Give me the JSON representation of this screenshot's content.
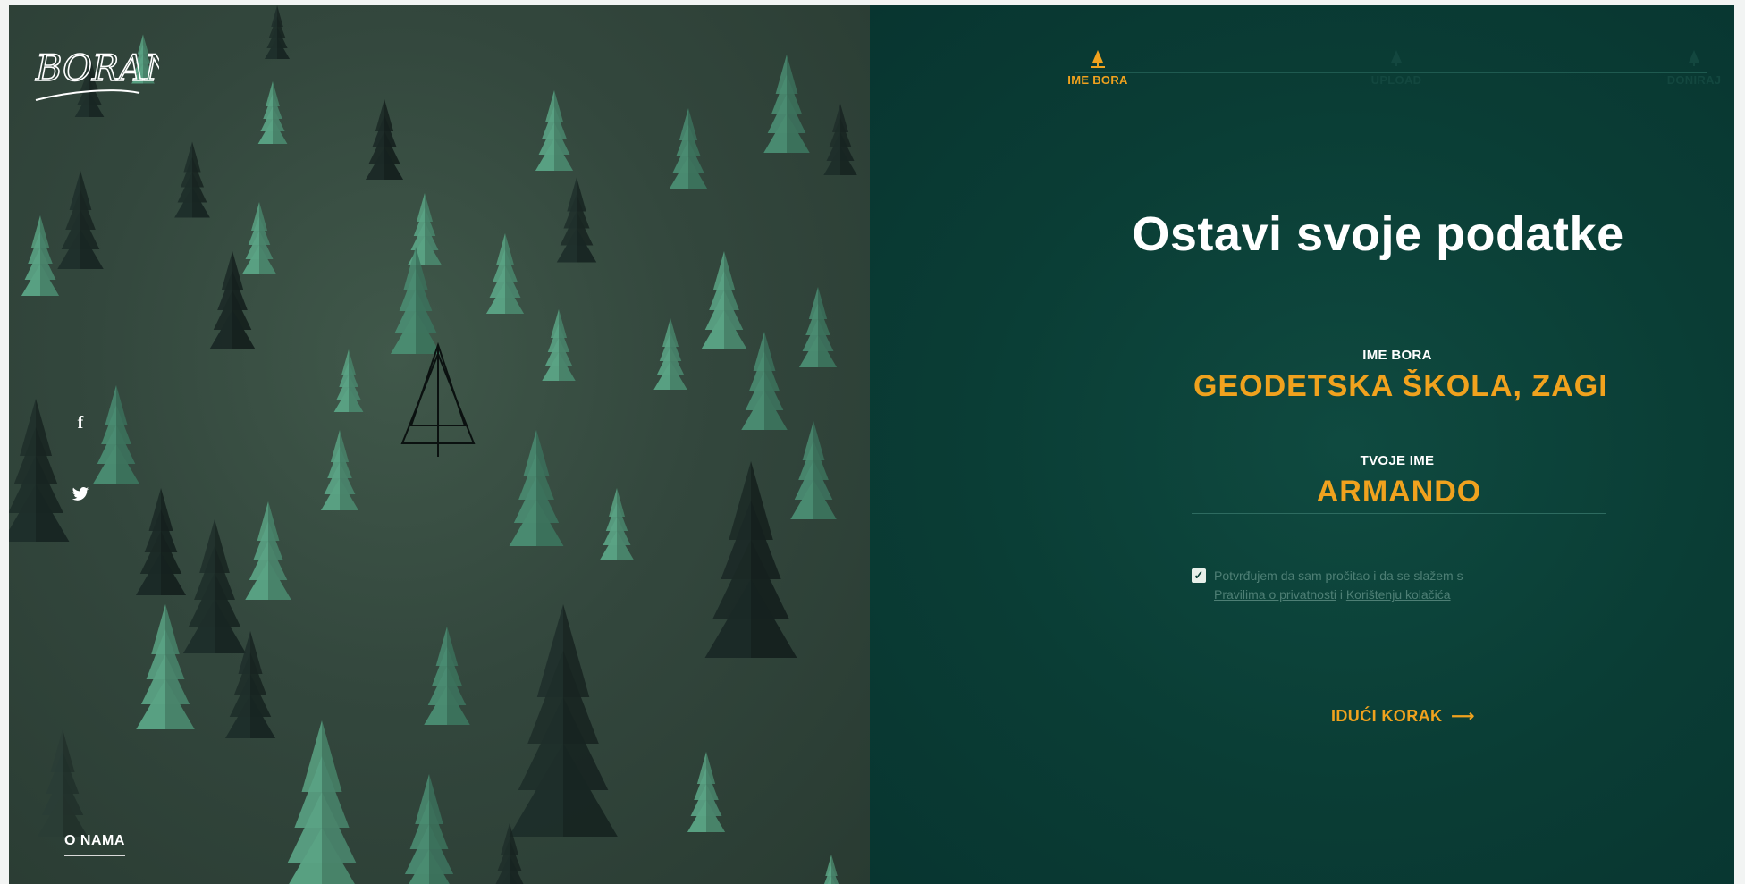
{
  "brand": {
    "logo_text": "BORANVI"
  },
  "social": {
    "facebook_glyph": "f",
    "twitter_glyph": "🐦"
  },
  "footer": {
    "about_label": "O NAMA"
  },
  "steps": [
    {
      "label": "IME BORA",
      "state": "active"
    },
    {
      "label": "UPLOAD",
      "state": "inactive"
    },
    {
      "label": "DONIRAJ",
      "state": "inactive"
    }
  ],
  "form": {
    "title": "Ostavi svoje podatke",
    "tree_name": {
      "label": "IME BORA",
      "value": "GEODETSKA ŠKOLA, ZAGREB"
    },
    "your_name": {
      "label": "TVOJE IME",
      "value": "ARMANDO"
    },
    "consent": {
      "checked": true,
      "text_before": "Potvrđujem da sam pročitao i da se slažem s",
      "privacy_link": "Pravilima o privatnosti",
      "and": "i",
      "cookies_link": "Korištenju kolačića"
    },
    "next_label": "IDUĆI KORAK",
    "next_arrow": "⟶"
  },
  "colors": {
    "accent": "#f0a21e",
    "panel_bg": "#0a3d35",
    "forest_bg": "#33473d",
    "tree_light": "#5aa384",
    "tree_dark": "#1e2e2a"
  }
}
